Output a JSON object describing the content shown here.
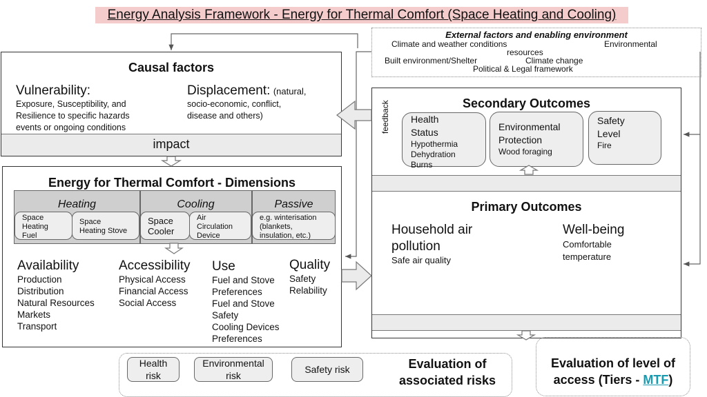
{
  "title": "Energy Analysis Framework - Energy for Thermal Comfort (Space Heating and Cooling)",
  "external": {
    "heading": "External factors and enabling environment",
    "items": [
      "Climate and weather conditions",
      "Environmental",
      "resources",
      "Built environment/Shelter",
      "Climate change",
      "Political & Legal framework"
    ]
  },
  "causal": {
    "heading": "Causal factors",
    "vulnerability": {
      "title": "Vulnerability:",
      "lines": [
        "Exposure, Susceptibility, and",
        "Resilience to specific hazards",
        "events or ongoing conditions"
      ]
    },
    "displacement": {
      "title": "Displacement:",
      "note": "(natural,",
      "lines": [
        "socio-economic, conflict,",
        "disease and others)"
      ]
    },
    "band_label": "impact"
  },
  "dimensions": {
    "heading": "Energy for Thermal Comfort - Dimensions",
    "groups": [
      {
        "label": "Heating",
        "items": [
          [
            "Space",
            "Heating",
            "Fuel"
          ],
          [
            "Space",
            "Heating Stove"
          ]
        ]
      },
      {
        "label": "Cooling",
        "items": [
          [
            "Space",
            "Cooler"
          ],
          [
            "Air",
            "Circulation",
            "Device"
          ]
        ]
      },
      {
        "label": "Passive",
        "items": [
          [
            "e.g. winterisation",
            "(blankets,",
            "insulation, etc.)"
          ]
        ]
      }
    ],
    "columns": [
      {
        "title": "Availability",
        "items": [
          "Production",
          "Distribution",
          "Natural Resources",
          "Markets",
          "Transport"
        ]
      },
      {
        "title": "Accessibility",
        "items": [
          "Physical Access",
          "Financial Access",
          "Social Access"
        ]
      },
      {
        "title": "Use",
        "items": [
          "Fuel and Stove",
          "Preferences",
          "Fuel and Stove",
          "Safety",
          "Cooling Devices",
          "Preferences"
        ]
      },
      {
        "title": "Quality",
        "items": [
          "Safety",
          "Relability"
        ]
      }
    ]
  },
  "feedback_label": "feedback",
  "secondary": {
    "heading": "Secondary Outcomes",
    "cards": [
      {
        "title": [
          "Health",
          "Status"
        ],
        "items": [
          "Hypothermia",
          "Dehydration",
          "Burns"
        ]
      },
      {
        "title": [
          "Environmental",
          "Protection"
        ],
        "items": [
          "Wood foraging"
        ]
      },
      {
        "title": [
          "Safety",
          "Level"
        ],
        "items": [
          "Fire"
        ]
      }
    ]
  },
  "primary": {
    "heading": "Primary Outcomes",
    "left": {
      "title": [
        "Household air",
        "pollution"
      ],
      "items": [
        "Safe air quality"
      ]
    },
    "right": {
      "title": [
        "Well-being"
      ],
      "items": [
        "Comfortable",
        "temperature"
      ]
    }
  },
  "risks": {
    "pills": [
      [
        "Health",
        "risk"
      ],
      [
        "Environmental",
        "risk"
      ],
      [
        "Safety risk"
      ]
    ],
    "heading": [
      "Evaluation of",
      "associated risks"
    ]
  },
  "access": {
    "line1": "Evaluation of level of",
    "line2_prefix": "access (Tiers - ",
    "link": "MTF",
    "line2_suffix": ")",
    "link_color": "#1a9ab0"
  }
}
